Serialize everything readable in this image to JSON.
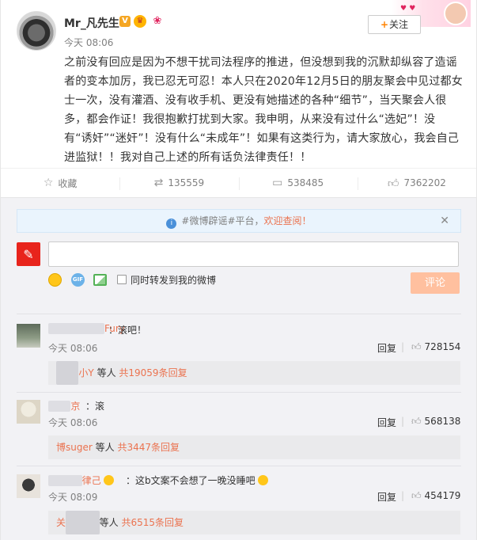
{
  "post": {
    "username": "Mr_凡先生",
    "verified_badge": "V",
    "time": "今天 08:06",
    "follow_label": "关注",
    "follow_plus": "+",
    "body": "之前没有回应是因为不想干扰司法程序的推进，但没想到我的沉默却纵容了造谣者的变本加厉，我已忍无可忍！本人只在2020年12月5日的朋友聚会中见过都女士一次，没有灌酒、没有收手机、更没有她描述的各种“细节”，当天聚会人很多，都会作证！我很抱歉打扰到大家。我申明，从来没有过什么“选妃”！没有“诱奸”“迷奸”！没有什么“未成年”！如果有这类行为，请大家放心，我会自己进监狱！！我对自己上述的所有话负法律责任！！"
  },
  "actions": {
    "favorite": "收藏",
    "repost": "135559",
    "comment": "538485",
    "like": "7362202"
  },
  "comments_panel": {
    "notice_prefix": "#微博辟谣#平台，",
    "notice_highlight": "欢迎查阅！",
    "comment_input_placeholder": "",
    "repost_label": "同时转发到我的微博",
    "submit_label": "评论"
  },
  "comments": [
    {
      "name": "Fury",
      "text": "：滚吧！",
      "time": "今天 08:06",
      "reply": "回复",
      "likes": "728154",
      "sub_who": "小Y",
      "sub_mid": " 等人 ",
      "sub_count": "共19059条回复"
    },
    {
      "name": "京",
      "text": "：滚",
      "time": "今天 08:06",
      "reply": "回复",
      "likes": "568138",
      "sub_who": "博suger",
      "sub_mid": " 等人 ",
      "sub_count": "共3447条回复"
    },
    {
      "name": "律己",
      "text": "：这b文案不会想了一晚没睡吧",
      "time": "今天 08:09",
      "reply": "回复",
      "likes": "454179",
      "sub_who": "关",
      "sub_mid": "等人 ",
      "sub_count": "共6515条回复"
    }
  ],
  "colors": {
    "accent": "#eb7350",
    "submit_disabled": "#ffc09f",
    "notice_bg": "#eaf4fd"
  }
}
